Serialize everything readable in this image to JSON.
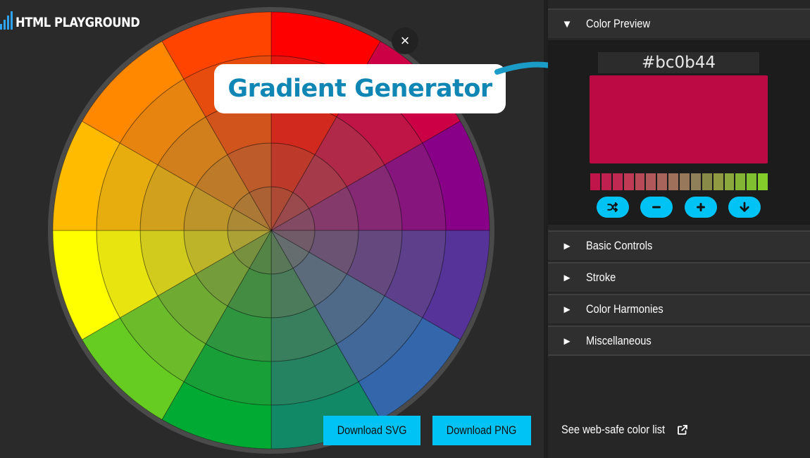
{
  "app": {
    "logo_text": "HTML PLAYGROUND",
    "close_glyph": "×"
  },
  "overlay": {
    "title": "Gradient Generator"
  },
  "downloads": {
    "svg_label": "Download SVG",
    "png_label": "Download PNG"
  },
  "sidebar": {
    "sections": [
      {
        "label": "Color Preview",
        "expanded": true
      },
      {
        "label": "Basic Controls",
        "expanded": false
      },
      {
        "label": "Stroke",
        "expanded": false
      },
      {
        "label": "Color Harmonies",
        "expanded": false
      },
      {
        "label": "Miscellaneous",
        "expanded": false
      }
    ],
    "expanded_glyph": "▼",
    "collapsed_glyph": "►"
  },
  "preview": {
    "hex": "#bc0b44",
    "swatch_color": "#bc0b44",
    "gradient_strip": [
      "#c0154a",
      "#c02050",
      "#c02a52",
      "#c03a55",
      "#b84a58",
      "#b0585a",
      "#a8645a",
      "#a0705a",
      "#98785a",
      "#90805a",
      "#888a48",
      "#909a40",
      "#8aa83c",
      "#84b434",
      "#80c030",
      "#84cc2a"
    ],
    "controls": [
      "shuffle-icon",
      "minus-icon",
      "plus-icon",
      "download-arrow-icon"
    ]
  },
  "footer": {
    "websafe_label": "See web-safe color list"
  },
  "colors": {
    "accent": "#00c3f5",
    "title_text": "#0f86b3",
    "arrow": "#1a9cc7"
  },
  "wheel": {
    "sector_colors": [
      "#ff0000",
      "#cc0044",
      "#880088",
      "#553399",
      "#3366aa",
      "#118866",
      "#00aa33",
      "#66cc22",
      "#ffff00",
      "#ffbb00",
      "#ff8800",
      "#ff4400"
    ],
    "ring_count": 5,
    "outline_color": "#4a4a4a"
  }
}
